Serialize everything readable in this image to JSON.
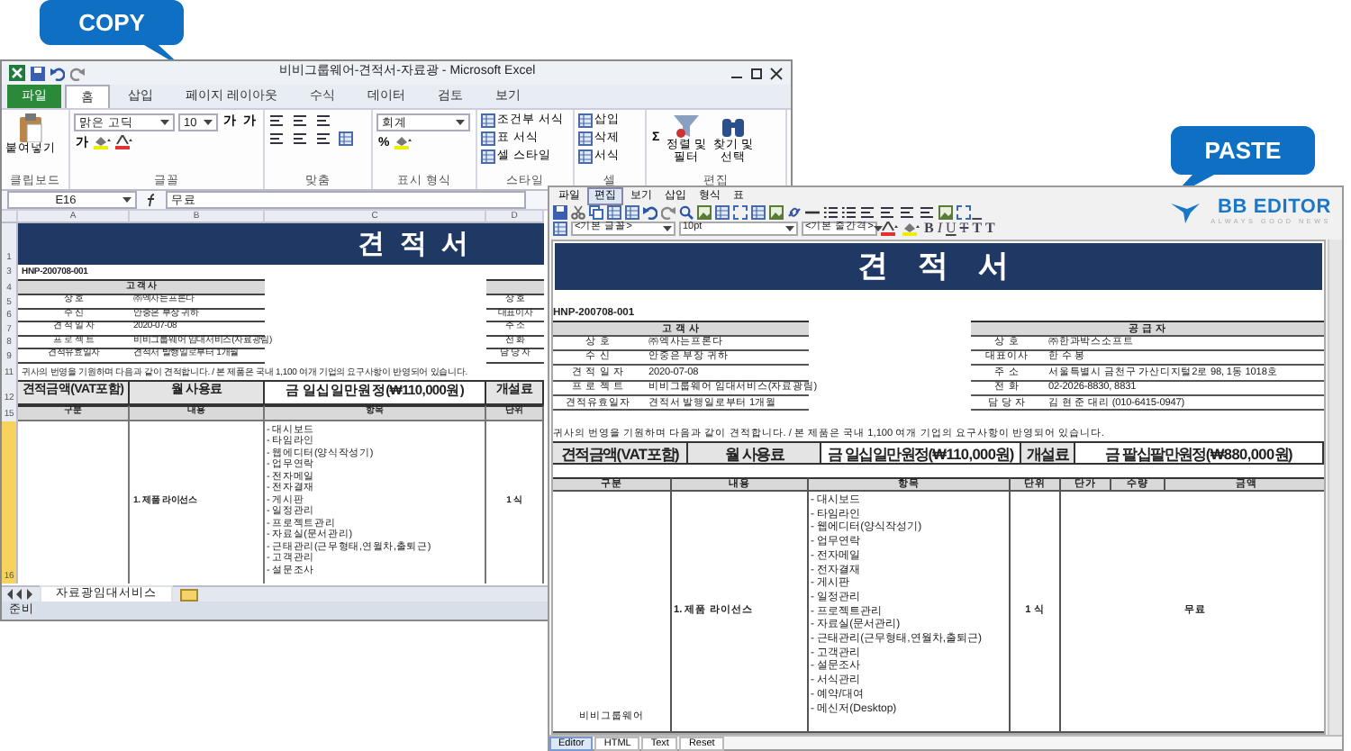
{
  "callouts": [
    {
      "text": "COPY"
    },
    {
      "text": "PASTE"
    }
  ],
  "excel": {
    "title": "비비그룹웨어-견적서-자료광 - Microsoft Excel",
    "tabs": [
      {
        "label": "파일",
        "kind": "file",
        "selected": false
      },
      {
        "label": "홈",
        "kind": "tab",
        "selected": true
      },
      {
        "label": "삽입",
        "kind": "tab",
        "selected": false
      },
      {
        "label": "페이지 레이아웃",
        "kind": "tab",
        "selected": false
      },
      {
        "label": "수식",
        "kind": "tab",
        "selected": false
      },
      {
        "label": "데이터",
        "kind": "tab",
        "selected": false
      },
      {
        "label": "검토",
        "kind": "tab",
        "selected": false
      },
      {
        "label": "보기",
        "kind": "tab",
        "selected": false
      }
    ],
    "groups": [
      {
        "label": "클립보드",
        "controls": [
          {
            "kind": "big",
            "label": "붙여넣기"
          }
        ]
      },
      {
        "label": "글꼴",
        "controls": [
          {
            "kind": "field",
            "value": "맑은 고딕"
          },
          {
            "kind": "field",
            "value": "10"
          },
          {
            "kind": "glyph",
            "text": "가"
          },
          {
            "kind": "glyph",
            "text": "가"
          },
          {
            "kind": "glyph",
            "text": "가"
          }
        ]
      },
      {
        "label": "맞춤"
      },
      {
        "label": "표시 형식",
        "controls": [
          {
            "kind": "field",
            "value": "회계"
          },
          {
            "kind": "glyph",
            "text": "%"
          }
        ]
      },
      {
        "label": "스타일",
        "controls": [
          {
            "kind": "small",
            "label": "조건부 서식"
          },
          {
            "kind": "small",
            "label": "표 서식"
          },
          {
            "kind": "small",
            "label": "셀 스타일"
          }
        ]
      },
      {
        "label": "셀",
        "controls": [
          {
            "kind": "small",
            "label": "삽입"
          },
          {
            "kind": "small",
            "label": "삭제"
          },
          {
            "kind": "small",
            "label": "서식"
          }
        ]
      },
      {
        "label": "편집",
        "controls": [
          {
            "kind": "glyph",
            "text": "Σ"
          },
          {
            "kind": "big",
            "label": "정렬 및 필터"
          },
          {
            "kind": "big",
            "label": "찾기 및 선택"
          }
        ]
      }
    ],
    "name_box": "E16",
    "formula": "무료",
    "columns": [
      "A",
      "B",
      "C",
      "D"
    ],
    "rows": [
      {
        "kind": "title",
        "number": "1",
        "text": "견 적 서"
      },
      {
        "kind": "docno",
        "number": "3",
        "text": "HNP-200708-001"
      },
      {
        "kind": "party_head",
        "number": "4",
        "text": "고 객 사"
      },
      {
        "kind": "party",
        "number": "5",
        "label": "상 호",
        "value": "㈜엑사는프론다",
        "supplier_label": "상 호"
      },
      {
        "kind": "party",
        "number": "6",
        "label": "수 신",
        "value": "안중은 부장 귀하",
        "supplier_label": "대표이사"
      },
      {
        "kind": "party",
        "number": "7",
        "label": "견 적 일 자",
        "value": "2020-07-08",
        "supplier_label": "주 소"
      },
      {
        "kind": "party",
        "number": "8",
        "label": "프 로 젝 트",
        "value": "비비그룹웨어 임대서비스(자료광림)",
        "supplier_label": "전 화"
      },
      {
        "kind": "party",
        "number": "9",
        "label": "견적유효일자",
        "value": "견적서 발행일로부터 1개월",
        "supplier_label": "담 당 자"
      },
      {
        "kind": "notice",
        "number": "11",
        "text": "귀사의 번영을 기원하며 다음과 같이 견적합니다. / 본 제품은 국내 1,100 여개 기업의 요구사항이 반영되어 있습니다."
      },
      {
        "kind": "amount",
        "number": "12",
        "cells": [
          "견적금액(VAT포함)",
          "월 사용료",
          "금 일십일만원정(₩110,000원)",
          "개설료"
        ]
      },
      {
        "kind": "header",
        "number": "15",
        "cells": [
          "구분",
          "내용",
          "항목",
          "단위"
        ]
      },
      {
        "kind": "line",
        "number": "16",
        "selected": true,
        "content": "1. 제품 라이선스",
        "unit": "1 식",
        "items": [
          "- 대시보드",
          "- 타임라인",
          "- 웹에디터(양식작성기)",
          "- 업무연락",
          "- 전자메일",
          "- 전자결재",
          "- 게시판",
          "- 일정관리",
          "- 프로젝트관리",
          "- 자료실(문서관리)",
          "- 근태관리(근무형태,연월차,출퇴근)",
          "- 고객관리",
          "- 설문조사"
        ]
      }
    ],
    "sheet_tab": "자료광임대서비스",
    "status": "준비"
  },
  "editor": {
    "menu": [
      {
        "label": "파일",
        "selected": false
      },
      {
        "label": "편집",
        "selected": true
      },
      {
        "label": "보기",
        "selected": false
      },
      {
        "label": "삽입",
        "selected": false
      },
      {
        "label": "형식",
        "selected": false
      },
      {
        "label": "표",
        "selected": false
      }
    ],
    "font": "<기본 글꼴>",
    "size": "10pt",
    "line_spacing": "<기본 줄간격>",
    "format_buttons": [
      {
        "kind": "bold",
        "text": "B"
      },
      {
        "kind": "italic",
        "text": "I"
      },
      {
        "kind": "underline",
        "text": "U"
      },
      {
        "kind": "strike",
        "text": "T"
      },
      {
        "kind": "sup",
        "text": "T"
      },
      {
        "kind": "sub",
        "text": "T"
      }
    ],
    "logo": {
      "name": "BB EDITOR",
      "tagline": "ALWAYS GOOD NEWS"
    },
    "document": {
      "title": "견 적 서",
      "doc_no": "HNP-200708-001",
      "customer": {
        "heading": "고 객 사",
        "rows": [
          {
            "label": "상 호",
            "value": "㈜엑사는프론다"
          },
          {
            "label": "수 신",
            "value": "안중은 부장 귀하"
          },
          {
            "label": "견 적 일 자",
            "value": "2020-07-08"
          },
          {
            "label": "프 로 젝 트",
            "value": "비비그룹웨어 임대서비스(자료광림)"
          },
          {
            "label": "견적유효일자",
            "value": "견적서 발행일로부터 1개월"
          }
        ]
      },
      "supplier": {
        "heading": "공 급 자",
        "rows": [
          {
            "label": "상 호",
            "value": "㈜한과박스소프트"
          },
          {
            "label": "대표이사",
            "value": "한 수 봉"
          },
          {
            "label": "주 소",
            "value": "서울특별시 금천구 가산디지털2로 98, 1동 1018호"
          },
          {
            "label": "전 화",
            "value": "02-2026-8830, 8831"
          },
          {
            "label": "담 당 자",
            "value": "김 현 준 대리 (010-6415-0947)"
          }
        ]
      },
      "notice": "귀사의 번영을 기원하며 다음과 같이 견적합니다. / 본 제품은 국내 1,100 여개 기업의 요구사항이 반영되어 있습니다.",
      "amounts": [
        "견적금액(VAT포함)",
        "월 사용료",
        "금 일십일만원정(₩110,000원)",
        "개설료",
        "금 팔십팔만원정(₩880,000원)"
      ],
      "columns": [
        "구분",
        "내용",
        "항목",
        "단위",
        "단가",
        "수량",
        "금액"
      ],
      "line": {
        "category": "비비그룹웨어",
        "content": "1. 제품 라이선스",
        "unit": "1 식",
        "amount": "무료",
        "items": [
          "- 대시보드",
          "- 타임라인",
          "- 웹에디터(양식작성기)",
          "- 업무연락",
          "- 전자메일",
          "- 전자결재",
          "- 게시판",
          "- 일정관리",
          "- 프로젝트관리",
          "- 자료실(문서관리)",
          "- 근태관리(근무형태,연월차,출퇴근)",
          "- 고객관리",
          "- 설문조사",
          "- 서식관리",
          "- 예약/대여",
          "- 메신저(Desktop)"
        ]
      }
    },
    "modes": [
      {
        "label": "Editor",
        "selected": true
      },
      {
        "label": "HTML",
        "selected": false
      },
      {
        "label": "Text",
        "selected": false
      },
      {
        "label": "Reset",
        "selected": false
      }
    ]
  }
}
